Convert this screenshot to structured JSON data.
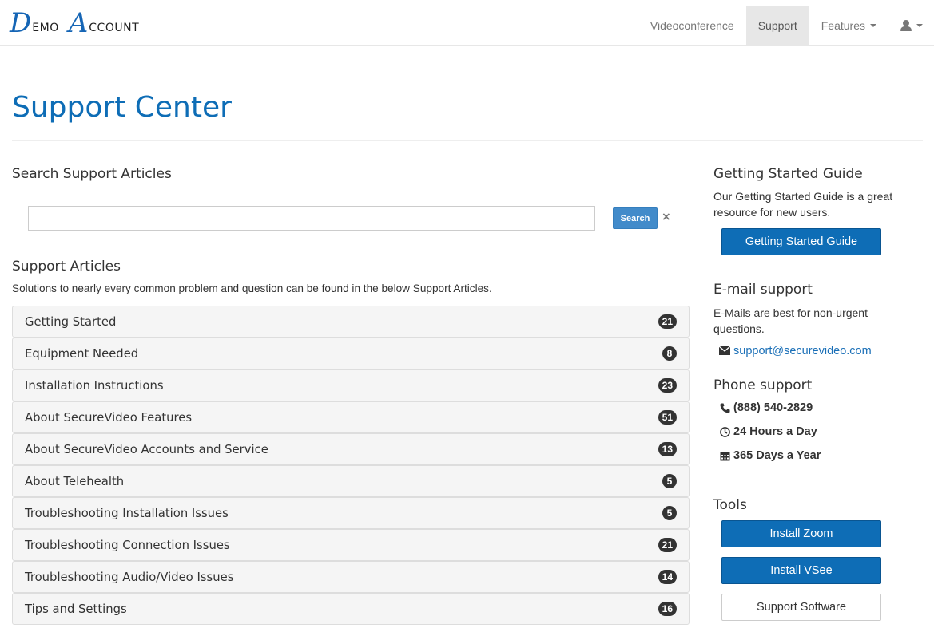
{
  "logo": {
    "cap1": "D",
    "rest1": "EMO",
    "cap2": "A",
    "rest2": "CCOUNT"
  },
  "nav": {
    "videoconference": "Videoconference",
    "support": "Support",
    "features": "Features"
  },
  "page": {
    "title": "Support Center"
  },
  "search": {
    "heading": "Search Support Articles",
    "value": "",
    "button": "Search",
    "clear": "×"
  },
  "articles": {
    "heading": "Support Articles",
    "intro": "Solutions to nearly every common problem and question can be found in the below Support Articles.",
    "items": [
      {
        "label": "Getting Started",
        "count": "21"
      },
      {
        "label": "Equipment Needed",
        "count": "8"
      },
      {
        "label": "Installation Instructions",
        "count": "23"
      },
      {
        "label": "About SecureVideo Features",
        "count": "51"
      },
      {
        "label": "About SecureVideo Accounts and Service",
        "count": "13"
      },
      {
        "label": "About Telehealth",
        "count": "5"
      },
      {
        "label": "Troubleshooting Installation Issues",
        "count": "5"
      },
      {
        "label": "Troubleshooting Connection Issues",
        "count": "21"
      },
      {
        "label": "Troubleshooting Audio/Video Issues",
        "count": "14"
      },
      {
        "label": "Tips and Settings",
        "count": "16"
      }
    ]
  },
  "sidebar": {
    "guide": {
      "heading": "Getting Started Guide",
      "text_line1": "Our Getting Started Guide is a great",
      "text_line2": "resource for new users.",
      "button": "Getting Started Guide"
    },
    "email": {
      "heading": "E-mail support",
      "text_line1": "E-Mails are best for non-urgent",
      "text_line2": "questions.",
      "address": "support@securevideo.com"
    },
    "phone": {
      "heading": "Phone support",
      "number": "(888) 540-2829",
      "hours": "24 Hours a Day",
      "days": "365 Days a Year"
    },
    "tools": {
      "heading": "Tools",
      "install_zoom": "Install Zoom",
      "install_vsee": "Install VSee",
      "support_software": "Support Software"
    }
  },
  "colors": {
    "brand": "#0e6db6",
    "badge": "#333333",
    "search_button": "#428bca"
  }
}
